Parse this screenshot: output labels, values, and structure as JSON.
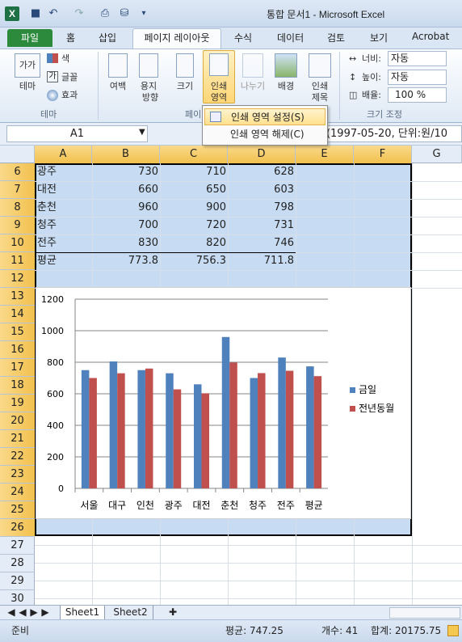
{
  "title": "통합 문서1 - Microsoft Excel",
  "tabs": {
    "file": "파일",
    "home": "홈",
    "insert": "삽입",
    "layout": "페이지 레이아웃",
    "formula": "수식",
    "data": "데이터",
    "review": "검토",
    "view": "보기",
    "acrobat": "Acrobat"
  },
  "ribbon": {
    "theme_big": "테마",
    "color": "색",
    "font": "글꼴",
    "effect": "효과",
    "theme_group": "테마",
    "margin": "여백",
    "orientation_1": "용지",
    "orientation_2": "방향",
    "size": "크기",
    "print_area_1": "인쇄",
    "print_area_2": "영역",
    "breaks": "나누기",
    "background": "배경",
    "print_titles_1": "인쇄",
    "print_titles_2": "제목",
    "page_group": "페이",
    "width_label": "너비:",
    "width_value": "자동",
    "height_label": "높이:",
    "height_value": "자동",
    "scale_label": "배율:",
    "scale_value": "100 %",
    "fit_group": "크기 조정"
  },
  "menu": {
    "set_print_area": "인쇄 영역 설정(S)",
    "clear_print_area": "인쇄 영역 해제(C)"
  },
  "namebox": "A1",
  "formula_text": "격(1997-05-20, 단위:원/10",
  "columns": [
    "A",
    "B",
    "C",
    "D",
    "E",
    "F",
    "G"
  ],
  "rows": [
    "6",
    "7",
    "8",
    "9",
    "10",
    "11",
    "12",
    "13",
    "14",
    "15",
    "16",
    "17",
    "18",
    "19",
    "20",
    "21",
    "22",
    "23",
    "24",
    "25",
    "26",
    "27",
    "28",
    "29",
    "30"
  ],
  "table": [
    [
      "광주",
      "730",
      "710",
      "628"
    ],
    [
      "대전",
      "660",
      "650",
      "603"
    ],
    [
      "춘천",
      "960",
      "900",
      "798"
    ],
    [
      "청주",
      "700",
      "720",
      "731"
    ],
    [
      "전주",
      "830",
      "820",
      "746"
    ],
    [
      "평균",
      "773.8",
      "756.3",
      "711.8"
    ]
  ],
  "chart_data": {
    "type": "bar",
    "categories": [
      "서울",
      "대구",
      "인천",
      "광주",
      "대전",
      "춘천",
      "청주",
      "전주",
      "평균"
    ],
    "series": [
      {
        "name": "금일",
        "color": "#4f81bd",
        "values": [
          750,
          805,
          750,
          730,
          660,
          960,
          700,
          830,
          773.8
        ]
      },
      {
        "name": "전년동월",
        "color": "#c0504d",
        "values": [
          700,
          730,
          760,
          628,
          603,
          798,
          731,
          746,
          711.8
        ]
      }
    ],
    "ylim": [
      0,
      1200
    ],
    "yticks": [
      "0",
      "200",
      "400",
      "600",
      "800",
      "1000",
      "1200"
    ],
    "grid": true,
    "legend": "right"
  },
  "sheets": [
    "Sheet1",
    "Sheet2"
  ],
  "status": {
    "ready": "준비",
    "average": "평균: 747.25",
    "count": "개수: 41",
    "sum": "합계: 20175.75"
  }
}
